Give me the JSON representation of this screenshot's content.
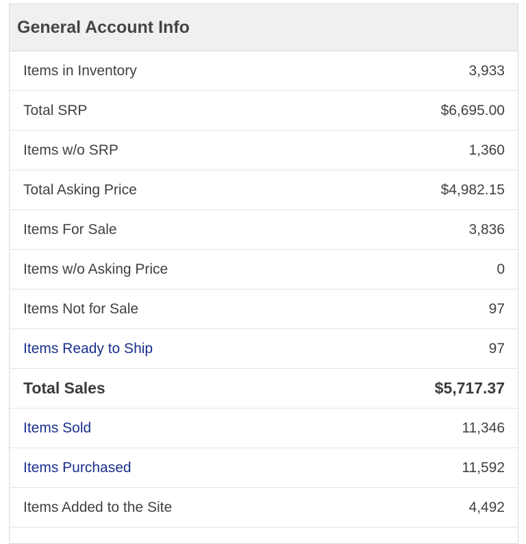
{
  "panel": {
    "title": "General Account Info",
    "rows": [
      {
        "label": "Items in Inventory",
        "value": "3,933"
      },
      {
        "label": "Total SRP",
        "value": "$6,695.00"
      },
      {
        "label": "Items w/o SRP",
        "value": "1,360"
      },
      {
        "label": "Total Asking Price",
        "value": "$4,982.15"
      },
      {
        "label": "Items For Sale",
        "value": "3,836"
      },
      {
        "label": "Items w/o Asking Price",
        "value": "0"
      },
      {
        "label": "Items Not for Sale",
        "value": "97"
      },
      {
        "label": "Items Ready to Ship",
        "value": "97"
      },
      {
        "label": "Total Sales",
        "value": "$5,717.37"
      },
      {
        "label": "Items Sold",
        "value": "11,346"
      },
      {
        "label": "Items Purchased",
        "value": "11,592"
      },
      {
        "label": "Items Added to the Site",
        "value": "4,492"
      }
    ]
  },
  "colors": {
    "header_bg": "#f0f0f0",
    "link": "#1a2f8c",
    "text": "#404040"
  }
}
